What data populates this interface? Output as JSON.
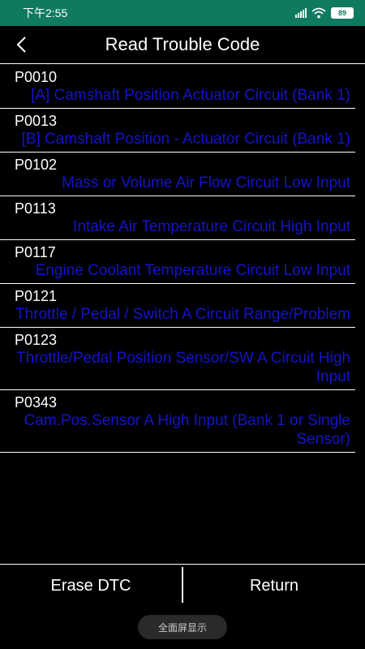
{
  "status_bar": {
    "time": "下午2:55",
    "battery": "89"
  },
  "header": {
    "title": "Read Trouble Code"
  },
  "dtc_list": [
    {
      "code": "P0010",
      "description": "[A] Camshaft Position Actuator Circuit (Bank 1)"
    },
    {
      "code": "P0013",
      "description": "[B] Camshaft Position - Actuator Circuit (Bank 1)"
    },
    {
      "code": "P0102",
      "description": "Mass or Volume Air Flow Circuit Low Input"
    },
    {
      "code": "P0113",
      "description": "Intake Air Temperature Circuit High Input"
    },
    {
      "code": "P0117",
      "description": "Engine Coolant Temperature Circuit Low Input"
    },
    {
      "code": "P0121",
      "description": "Throttle / Pedal / Switch A Circuit Range/Problem"
    },
    {
      "code": "P0123",
      "description": "Throttle/Pedal Position Sensor/SW A Circuit High Input"
    },
    {
      "code": "P0343",
      "description": "Cam.Pos.Sensor A High Input (Bank 1 or Single Sensor)"
    }
  ],
  "footer": {
    "erase_label": "Erase DTC",
    "return_label": "Return"
  },
  "system": {
    "fullscreen_label": "全面屏显示"
  }
}
